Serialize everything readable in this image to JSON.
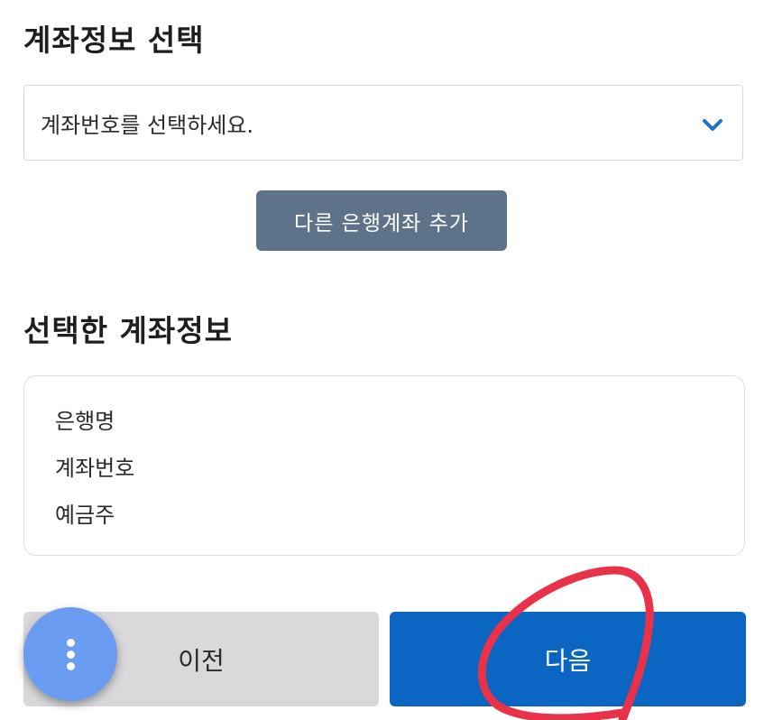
{
  "account_section": {
    "title": "계좌정보 선택",
    "select_placeholder": "계좌번호를 선택하세요."
  },
  "add_account_button": {
    "label": "다른 은행계좌 추가"
  },
  "selected_section": {
    "title": "선택한 계좌정보",
    "rows": [
      {
        "label": "은행명"
      },
      {
        "label": "계좌번호"
      },
      {
        "label": "예금주"
      }
    ]
  },
  "footer": {
    "prev_label": "이전",
    "next_label": "다음"
  },
  "icons": {
    "select_chevron": "chevron-down-icon",
    "fab": "more-vertical-icon"
  },
  "colors": {
    "add_button_bg": "#5e738a",
    "next_button_bg": "#0a66c2",
    "prev_button_bg": "#d9d9dc",
    "chevron": "#1a73c9",
    "fab_bg": "#6a9cf1",
    "annotation_circle": "#e8324a"
  }
}
